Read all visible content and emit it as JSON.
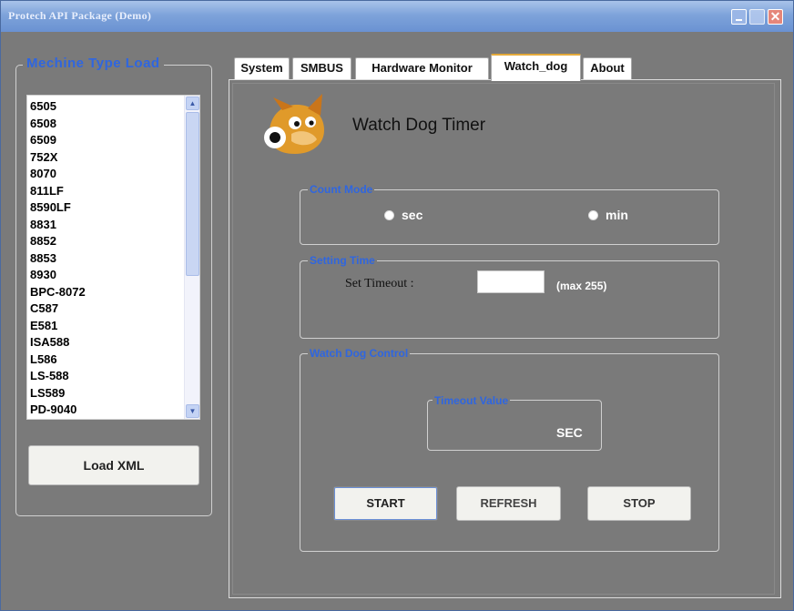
{
  "window": {
    "title": "Protech API Package (Demo)",
    "close_glyph": "✕"
  },
  "machine": {
    "legend": "Mechine Type Load",
    "items": [
      "6505",
      "6508",
      "6509",
      "752X",
      "8070",
      "811LF",
      "8590LF",
      "8831",
      "8852",
      "8853",
      "8930",
      "BPC-8072",
      "C587",
      "E581",
      "ISA588",
      "L586",
      "LS-588",
      "LS589",
      "PD-9040"
    ],
    "load_button": "Load XML"
  },
  "tabs": [
    "System",
    "SMBUS",
    "Hardware Monitor",
    "Watch_dog",
    "About"
  ],
  "active_tab": "Watch_dog",
  "watchdog": {
    "title": "Watch Dog Timer",
    "logo_icon": "dog-mascot-icon",
    "count_mode": {
      "legend": "Count Mode",
      "options": [
        "sec",
        "min"
      ]
    },
    "setting_time": {
      "legend": "Setting Time",
      "label": "Set Timeout :",
      "value": "",
      "note": "(max 255)"
    },
    "control": {
      "legend": "Watch Dog Control",
      "timeout_value_legend": "Timeout Value",
      "unit": "SEC",
      "start": "START",
      "refresh": "REFRESH",
      "stop": "STOP"
    }
  },
  "colors": {
    "legend_blue": "#2f66e0",
    "titlebar": "#7ea3da",
    "background": "#7a7a7a"
  }
}
